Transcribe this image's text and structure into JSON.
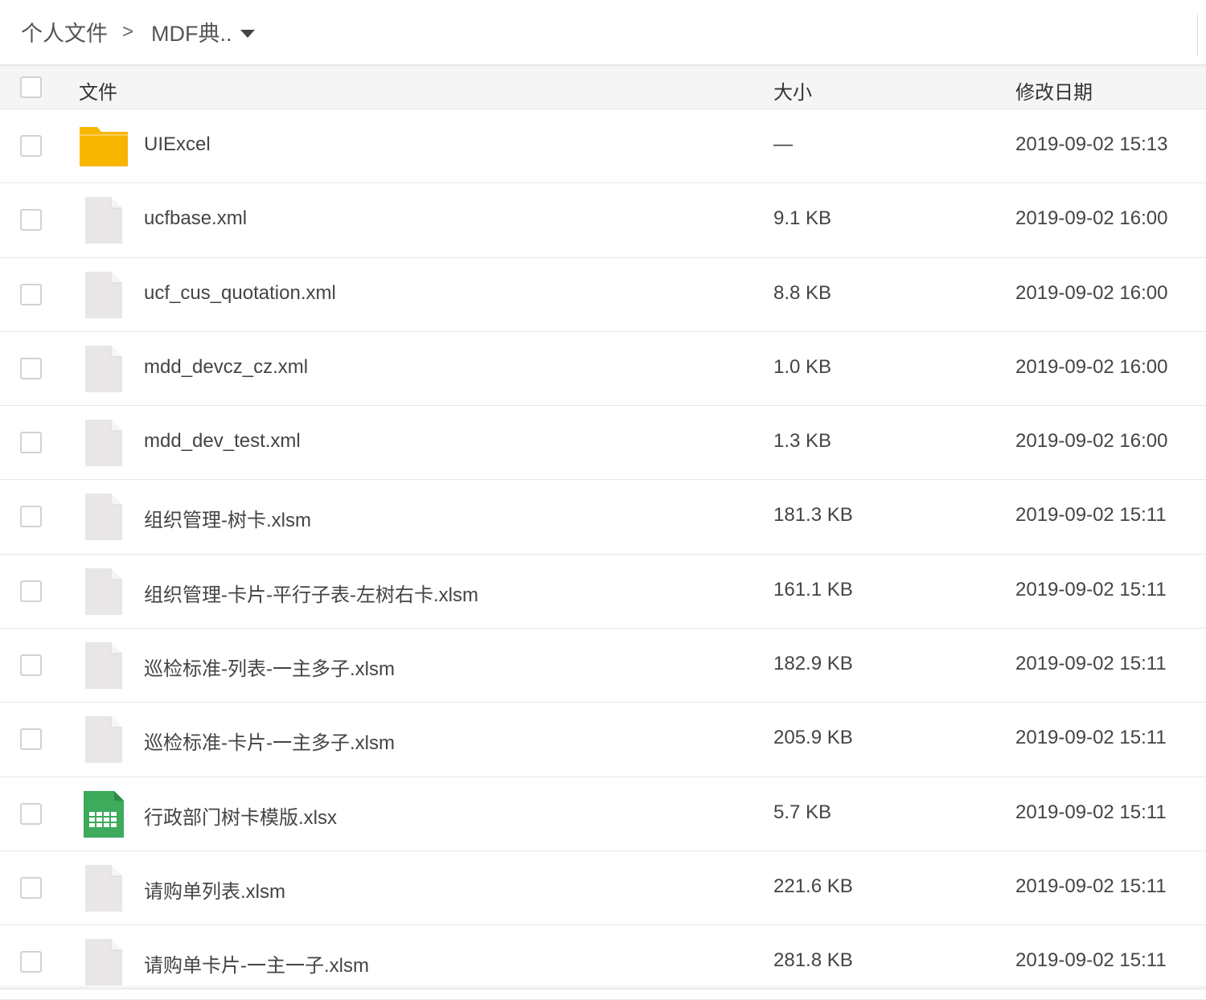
{
  "breadcrumb": {
    "root_label": "个人文件",
    "separator": ">",
    "current_label": "MDF典.."
  },
  "table": {
    "headers": {
      "name": "文件",
      "size": "大小",
      "modified": "修改日期"
    },
    "rows": [
      {
        "icon": "folder-icon",
        "name": "UIExcel",
        "size": "—",
        "modified": "2019-09-02 15:13"
      },
      {
        "icon": "document-icon",
        "name": "ucfbase.xml",
        "size": "9.1 KB",
        "modified": "2019-09-02 16:00"
      },
      {
        "icon": "document-icon",
        "name": "ucf_cus_quotation.xml",
        "size": "8.8 KB",
        "modified": "2019-09-02 16:00"
      },
      {
        "icon": "document-icon",
        "name": "mdd_devcz_cz.xml",
        "size": "1.0 KB",
        "modified": "2019-09-02 16:00"
      },
      {
        "icon": "document-icon",
        "name": "mdd_dev_test.xml",
        "size": "1.3 KB",
        "modified": "2019-09-02 16:00"
      },
      {
        "icon": "document-icon",
        "name": "组织管理-树卡.xlsm",
        "size": "181.3 KB",
        "modified": "2019-09-02 15:11"
      },
      {
        "icon": "document-icon",
        "name": "组织管理-卡片-平行子表-左树右卡.xlsm",
        "size": "161.1 KB",
        "modified": "2019-09-02 15:11"
      },
      {
        "icon": "document-icon",
        "name": "巡检标准-列表-一主多子.xlsm",
        "size": "182.9 KB",
        "modified": "2019-09-02 15:11"
      },
      {
        "icon": "document-icon",
        "name": "巡检标准-卡片-一主多子.xlsm",
        "size": "205.9 KB",
        "modified": "2019-09-02 15:11"
      },
      {
        "icon": "spreadsheet-icon",
        "name": "行政部门树卡模版.xlsx",
        "size": "5.7 KB",
        "modified": "2019-09-02 15:11"
      },
      {
        "icon": "document-icon",
        "name": "请购单列表.xlsm",
        "size": "221.6 KB",
        "modified": "2019-09-02 15:11"
      },
      {
        "icon": "document-icon",
        "name": "请购单卡片-一主一子.xlsm",
        "size": "281.8 KB",
        "modified": "2019-09-02 15:11"
      }
    ]
  },
  "colors": {
    "folder": "#F7B500",
    "spreadsheet": "#3DAA5C",
    "document": "#E8E6E6",
    "header_bg": "#F5F5F5",
    "border": "#E6E6E6"
  }
}
